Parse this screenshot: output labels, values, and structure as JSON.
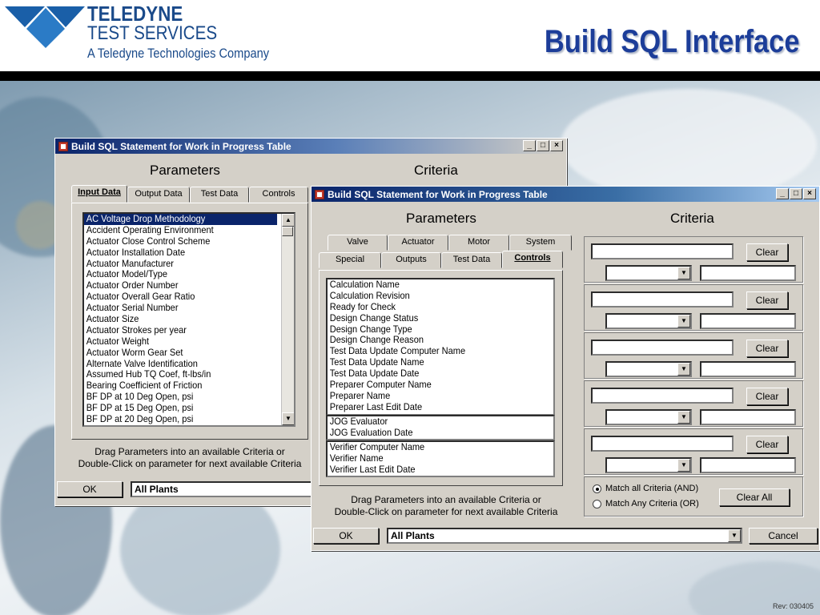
{
  "header": {
    "logo_line1": "TELEDYNE",
    "logo_line2": "TEST SERVICES",
    "logo_line3": "A Teledyne Technologies Company",
    "title": "Build SQL Interface"
  },
  "footer": {
    "rev": "Rev: 030405"
  },
  "window_back": {
    "title": "Build SQL Statement for Work in Progress Table",
    "controls": {
      "minimize": "_",
      "maximize": "□",
      "close": "×"
    },
    "parameters_label": "Parameters",
    "criteria_label": "Criteria",
    "tabs": [
      "Input Data",
      "Output Data",
      "Test Data",
      "Controls"
    ],
    "active_tab": "Input Data",
    "list_items": [
      "AC Voltage Drop Methodology",
      "Accident Operating Environment",
      "Actuator Close Control Scheme",
      "Actuator Installation Date",
      "Actuator Manufacturer",
      "Actuator Model/Type",
      "Actuator Order Number",
      "Actuator Overall Gear Ratio",
      "Actuator Serial Number",
      "Actuator Size",
      "Actuator Strokes per year",
      "Actuator Weight",
      "Actuator Worm Gear Set",
      "Alternate Valve Identification",
      "Assumed Hub TQ Coef, ft-lbs/in",
      "Bearing Coefficient of Friction",
      "BF DP at 10 Deg Open, psi",
      "BF DP at 15 Deg Open, psi",
      "BF DP at 20 Deg Open, psi"
    ],
    "selected_item": "AC Voltage Drop Methodology",
    "note_line1": "Drag Parameters into an available Criteria or",
    "note_line2": "Double-Click on parameter for next available Criteria",
    "ok_label": "OK",
    "plant_value": "All Plants"
  },
  "window_front": {
    "title": "Build SQL Statement for Work in Progress Table",
    "controls": {
      "minimize": "_",
      "maximize": "□",
      "close": "×"
    },
    "parameters_label": "Parameters",
    "criteria_label": "Criteria",
    "tabs_row1": [
      "Valve",
      "Actuator",
      "Motor",
      "System"
    ],
    "tabs_row2": [
      "Special",
      "Outputs",
      "Test Data",
      "Controls"
    ],
    "active_tab": "Controls",
    "list_group1": [
      "Calculation Name",
      "Calculation Revision",
      "Ready for Check",
      "Design Change Status",
      "Design Change Type",
      "Design Change Reason",
      "Test Data Update Computer Name",
      "Test Data Update Name",
      "Test Data Update Date",
      "Preparer Computer Name",
      "Preparer Name",
      "Preparer Last Edit Date"
    ],
    "list_group2": [
      "JOG Evaluator",
      "JOG Evaluation Date"
    ],
    "list_group3": [
      "Verifier Computer Name",
      "Verifier Name",
      "Verifier Last Edit Date"
    ],
    "criteria_rows": [
      {
        "field_value": "",
        "clear_label": "Clear",
        "operator_value": "",
        "value": ""
      },
      {
        "field_value": "",
        "clear_label": "Clear",
        "operator_value": "",
        "value": ""
      },
      {
        "field_value": "",
        "clear_label": "Clear",
        "operator_value": "",
        "value": ""
      },
      {
        "field_value": "",
        "clear_label": "Clear",
        "operator_value": "",
        "value": ""
      },
      {
        "field_value": "",
        "clear_label": "Clear",
        "operator_value": "",
        "value": ""
      }
    ],
    "match_all_label": "Match all Criteria (AND)",
    "match_any_label": "Match Any Criteria (OR)",
    "match_selected": "all",
    "clear_all_label": "Clear All",
    "note_line1": "Drag Parameters into an available Criteria or",
    "note_line2": "Double-Click on parameter for next available Criteria",
    "ok_label": "OK",
    "plant_value": "All Plants",
    "cancel_label": "Cancel"
  },
  "icons": {
    "logo": "teledyne-logo-icon",
    "app": "app-icon",
    "dropdown": "chevron-down-icon",
    "scroll_up": "scroll-up-icon",
    "scroll_down": "scroll-down-icon"
  },
  "colors": {
    "title_blue": "#1c3d99",
    "logo_blue": "#1a4a8a",
    "titlebar": "#0a246a",
    "selection": "#0a246a",
    "window_face": "#d4d0c8"
  }
}
